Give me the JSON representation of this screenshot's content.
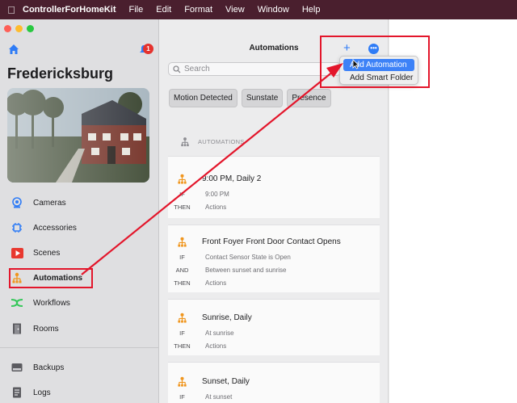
{
  "menubar": {
    "app_name": "ControllerForHomeKit",
    "items": [
      "File",
      "Edit",
      "Format",
      "View",
      "Window",
      "Help"
    ]
  },
  "sidebar": {
    "home_name": "Fredericksburg",
    "notification_count": "1",
    "nav": [
      {
        "label": "Cameras",
        "icon": "camera-icon"
      },
      {
        "label": "Accessories",
        "icon": "chip-icon"
      },
      {
        "label": "Scenes",
        "icon": "play-icon"
      },
      {
        "label": "Automations",
        "icon": "automation-icon"
      },
      {
        "label": "Workflows",
        "icon": "workflow-icon"
      },
      {
        "label": "Rooms",
        "icon": "door-icon"
      }
    ],
    "bottom_nav": [
      {
        "label": "Backups",
        "icon": "drive-icon"
      },
      {
        "label": "Logs",
        "icon": "document-icon"
      }
    ]
  },
  "list": {
    "title": "Automations",
    "search_placeholder": "Search",
    "chips": [
      "Motion Detected",
      "Sunstate",
      "Presence"
    ],
    "section_label": "AUTOMATIONS",
    "automations": [
      {
        "name": "9:00 PM, Daily 2",
        "rows": [
          {
            "k": "IF",
            "v": "9:00 PM"
          },
          {
            "k": "THEN",
            "v": "Actions"
          }
        ]
      },
      {
        "name": "Front Foyer Front Door Contact Opens",
        "rows": [
          {
            "k": "IF",
            "v": "Contact Sensor State is Open"
          },
          {
            "k": "AND",
            "v": "Between sunset and sunrise"
          },
          {
            "k": "THEN",
            "v": "Actions"
          }
        ]
      },
      {
        "name": "Sunrise, Daily",
        "rows": [
          {
            "k": "IF",
            "v": "At sunrise"
          },
          {
            "k": "THEN",
            "v": "Actions"
          }
        ]
      },
      {
        "name": "Sunset, Daily",
        "rows": [
          {
            "k": "IF",
            "v": "At sunset"
          }
        ]
      }
    ]
  },
  "toolbar": {
    "add_symbol": "+",
    "more_symbol": "•••"
  },
  "dropdown": {
    "items": [
      "Add Automation",
      "Add Smart Folder"
    ],
    "selected": "Add Automation"
  },
  "colors": {
    "accent": "#2f7cf6",
    "annotation": "#e3162b",
    "menubar": "#4a1f2e",
    "automation_icon": "#f0961e"
  }
}
